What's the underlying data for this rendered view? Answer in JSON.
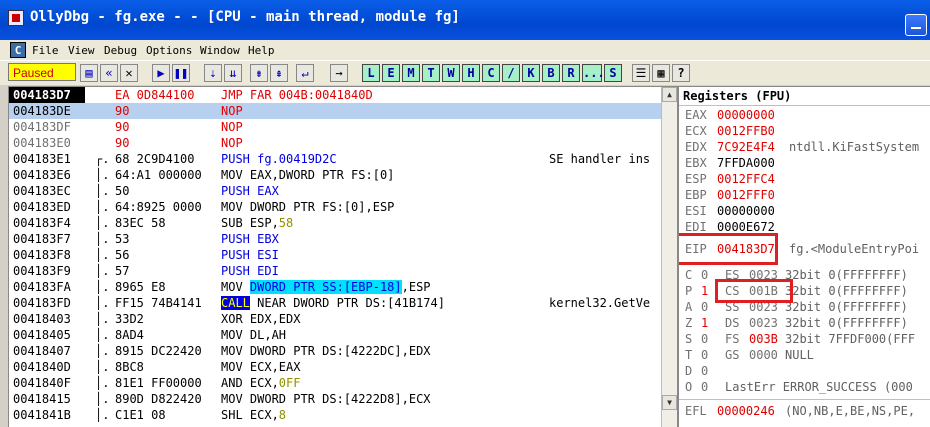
{
  "window": {
    "title": "OllyDbg - fg.exe - - [CPU - main thread, module fg]"
  },
  "menu": {
    "icon_letter": "C",
    "items": [
      "File",
      "View",
      "Debug",
      "Options",
      "Window",
      "Help"
    ]
  },
  "toolbar": {
    "status": "Paused",
    "letters": [
      "L",
      "E",
      "M",
      "T",
      "W",
      "H",
      "C",
      "/",
      "K",
      "B",
      "R",
      "...",
      "S"
    ]
  },
  "disasm": {
    "rows": [
      {
        "addr": "004183D7",
        "mark": "",
        "hex": "EA 0D844100",
        "asm": "JMP FAR 004B:0041840D",
        "cmt": "",
        "style": "cur"
      },
      {
        "addr": "004183DE",
        "mark": "",
        "hex": "90",
        "asm": "NOP",
        "cmt": "",
        "style": "sel"
      },
      {
        "addr": "004183DF",
        "mark": "",
        "hex": "90",
        "asm": "NOP",
        "cmt": "",
        "style": "gray"
      },
      {
        "addr": "004183E0",
        "mark": "",
        "hex": "90",
        "asm": "NOP",
        "cmt": "",
        "style": "gray"
      },
      {
        "addr": "004183E1",
        "mark": "┌.",
        "hex": "68 2C9D4100",
        "asm": "PUSH fg.00419D2C",
        "cmt": "SE handler ins",
        "style": ""
      },
      {
        "addr": "004183E6",
        "mark": "│.",
        "hex": "64:A1 000000",
        "asm": "MOV EAX,DWORD PTR FS:[0]",
        "cmt": "",
        "style": ""
      },
      {
        "addr": "004183EC",
        "mark": "│.",
        "hex": "50",
        "asm": "PUSH EAX",
        "cmt": "",
        "style": ""
      },
      {
        "addr": "004183ED",
        "mark": "│.",
        "hex": "64:8925 0000",
        "asm": "MOV DWORD PTR FS:[0],ESP",
        "cmt": "",
        "style": ""
      },
      {
        "addr": "004183F4",
        "mark": "│.",
        "hex": "83EC 58",
        "asm": "SUB ESP,58",
        "cmt": "",
        "style": ""
      },
      {
        "addr": "004183F7",
        "mark": "│.",
        "hex": "53",
        "asm": "PUSH EBX",
        "cmt": "",
        "style": ""
      },
      {
        "addr": "004183F8",
        "mark": "│.",
        "hex": "56",
        "asm": "PUSH ESI",
        "cmt": "",
        "style": ""
      },
      {
        "addr": "004183F9",
        "mark": "│.",
        "hex": "57",
        "asm": "PUSH EDI",
        "cmt": "",
        "style": ""
      },
      {
        "addr": "004183FA",
        "mark": "│.",
        "hex": "8965 E8",
        "asm": "MOV DWORD PTR SS:[EBP-18],ESP",
        "cmt": "",
        "style": ""
      },
      {
        "addr": "004183FD",
        "mark": "│.",
        "hex": "FF15 74B4141",
        "asm": "CALL NEAR DWORD PTR DS:[41B174]",
        "cmt": "kernel32.GetVe",
        "style": ""
      },
      {
        "addr": "00418403",
        "mark": "│.",
        "hex": "33D2",
        "asm": "XOR EDX,EDX",
        "cmt": "",
        "style": ""
      },
      {
        "addr": "00418405",
        "mark": "│.",
        "hex": "8AD4",
        "asm": "MOV DL,AH",
        "cmt": "",
        "style": ""
      },
      {
        "addr": "00418407",
        "mark": "│.",
        "hex": "8915 DC22420",
        "asm": "MOV DWORD PTR DS:[4222DC],EDX",
        "cmt": "",
        "style": ""
      },
      {
        "addr": "0041840D",
        "mark": "│.",
        "hex": "8BC8",
        "asm": "MOV ECX,EAX",
        "cmt": "",
        "style": ""
      },
      {
        "addr": "0041840F",
        "mark": "│.",
        "hex": "81E1 FF00000",
        "asm": "AND ECX,0FF",
        "cmt": "",
        "style": ""
      },
      {
        "addr": "00418415",
        "mark": "│.",
        "hex": "890D D822420",
        "asm": "MOV DWORD PTR DS:[4222D8],ECX",
        "cmt": "",
        "style": ""
      },
      {
        "addr": "0041841B",
        "mark": "│.",
        "hex": "C1E1 08",
        "asm": "SHL ECX,8",
        "cmt": "",
        "style": ""
      }
    ]
  },
  "registers": {
    "title": "Registers (FPU)",
    "general": [
      {
        "name": "EAX",
        "value": "00000000",
        "extra": "",
        "changed": true
      },
      {
        "name": "ECX",
        "value": "0012FFB0",
        "extra": "",
        "changed": true
      },
      {
        "name": "EDX",
        "value": "7C92E4F4",
        "extra": "ntdll.KiFastSystem",
        "changed": true
      },
      {
        "name": "EBX",
        "value": "7FFDA000",
        "extra": "",
        "changed": false
      },
      {
        "name": "ESP",
        "value": "0012FFC4",
        "extra": "",
        "changed": true
      },
      {
        "name": "EBP",
        "value": "0012FFF0",
        "extra": "",
        "changed": true
      },
      {
        "name": "ESI",
        "value": "00000000",
        "extra": "",
        "changed": false
      },
      {
        "name": "EDI",
        "value": "0000E672",
        "extra": "",
        "changed": false
      }
    ],
    "eip": {
      "name": "EIP",
      "value": "004183D7",
      "extra": "fg.<ModuleEntryPoi"
    },
    "flags": [
      {
        "flag": "C",
        "fval": "0",
        "seg": "ES",
        "sval": "0023",
        "desc": "32bit 0(FFFFFFFF)",
        "fchanged": false,
        "schanged": false
      },
      {
        "flag": "P",
        "fval": "1",
        "seg": "CS",
        "sval": "001B",
        "desc": "32bit 0(FFFFFFFF)",
        "fchanged": true,
        "schanged": false
      },
      {
        "flag": "A",
        "fval": "0",
        "seg": "SS",
        "sval": "0023",
        "desc": "32bit 0(FFFFFFFF)",
        "fchanged": false,
        "schanged": false
      },
      {
        "flag": "Z",
        "fval": "1",
        "seg": "DS",
        "sval": "0023",
        "desc": "32bit 0(FFFFFFFF)",
        "fchanged": true,
        "schanged": false
      },
      {
        "flag": "S",
        "fval": "0",
        "seg": "FS",
        "sval": "003B",
        "desc": "32bit 7FFDF000(FFF",
        "fchanged": false,
        "schanged": true
      },
      {
        "flag": "T",
        "fval": "0",
        "seg": "GS",
        "sval": "0000",
        "desc": "NULL",
        "fchanged": false,
        "schanged": false
      },
      {
        "flag": "D",
        "fval": "0",
        "seg": "",
        "sval": "",
        "desc": "",
        "fchanged": false,
        "schanged": false
      },
      {
        "flag": "O",
        "fval": "0",
        "seg": "",
        "sval": "",
        "desc": "LastErr ERROR_SUCCESS (000",
        "fchanged": false,
        "schanged": false
      }
    ],
    "efl": {
      "name": "EFL",
      "value": "00000246",
      "extra": "(NO,NB,E,BE,NS,PE,"
    }
  },
  "colors": {
    "highlight_box": "#e02020",
    "changed": "#e00000",
    "titlebar": "#0047cf"
  }
}
